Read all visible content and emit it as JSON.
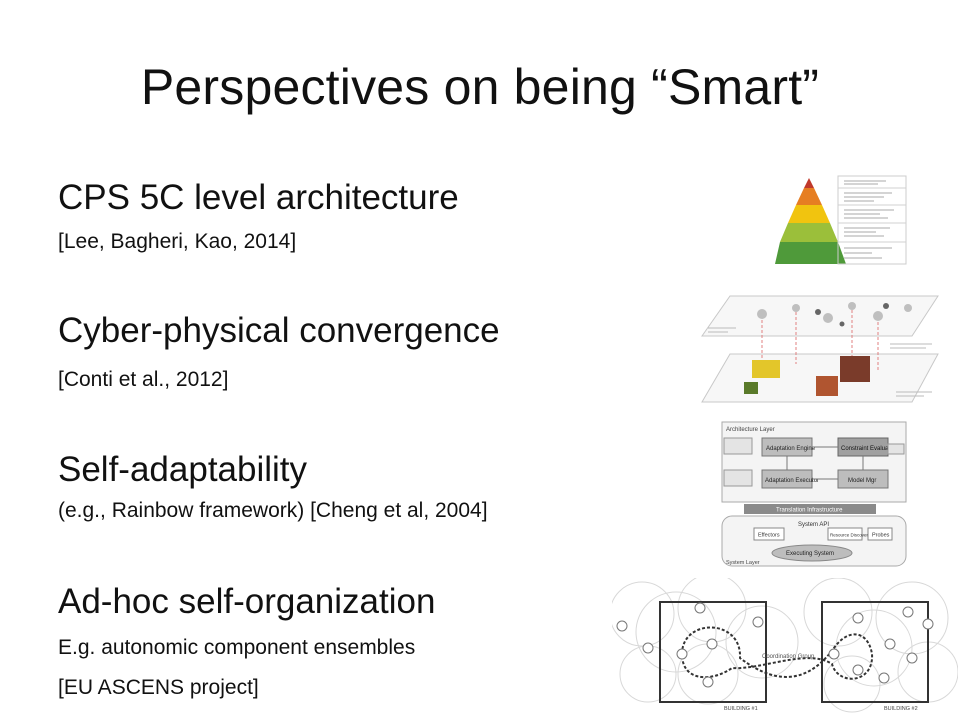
{
  "slide": {
    "title": "Perspectives on being “Smart”",
    "items": [
      {
        "heading": "CPS 5C level architecture",
        "citation": "[Lee, Bagheri, Kao, 2014]"
      },
      {
        "heading": "Cyber-physical convergence",
        "citation": "[Conti et al., 2012]"
      },
      {
        "heading": "Self-adaptability",
        "citation": "(e.g., Rainbow framework) [Cheng et al, 2004]"
      },
      {
        "heading": "Ad-hoc self-organization",
        "line1": "E.g. autonomic component ensembles",
        "line2": "[EU ASCENS project]"
      }
    ]
  },
  "figures": {
    "adapt": {
      "layer_top": "Architecture Layer",
      "engine": "Adaptation Engine",
      "evaluator": "Constraint Evaluator",
      "executor": "Adaptation Executor",
      "manager": "Model Mgr",
      "infra": "Translation Infrastructure",
      "api": "System API",
      "effectors": "Effectors",
      "resource": "Resource Discovery",
      "probes": "Probes",
      "executing": "Executing System",
      "layer_bottom": "System Layer"
    },
    "ensemble": {
      "group": "Coordination Group",
      "building1": "BUILDING #1",
      "building2": "BUILDING #2"
    }
  },
  "colors": {
    "pyramid_top": "#c0392b",
    "pyramid_upper": "#e67e22",
    "pyramid_mid": "#f1c40f",
    "pyramid_lower": "#9bbf3a",
    "pyramid_base": "#4f9a3a"
  }
}
